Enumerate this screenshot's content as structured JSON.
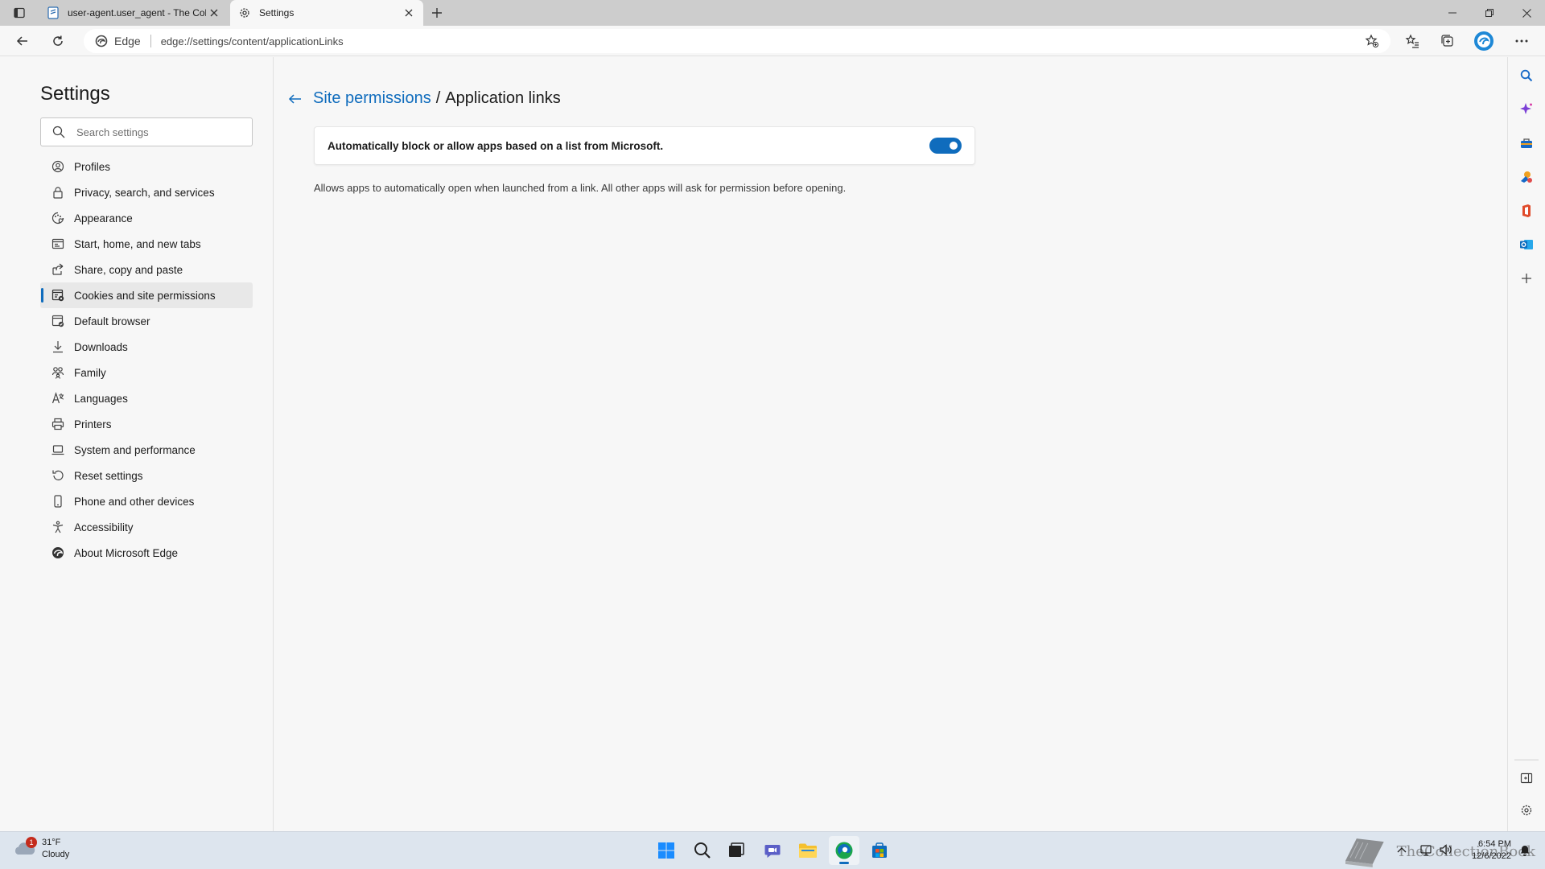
{
  "browser": {
    "tabs": [
      {
        "title": "user-agent.user_agent - The Coll",
        "icon": "document-icon"
      },
      {
        "title": "Settings",
        "icon": "gear-icon"
      }
    ],
    "address": {
      "edge_label": "Edge",
      "url": "edge://settings/content/applicationLinks"
    }
  },
  "settings": {
    "title": "Settings",
    "search_placeholder": "Search settings",
    "nav": [
      {
        "label": "Profiles",
        "icon": "profile-icon"
      },
      {
        "label": "Privacy, search, and services",
        "icon": "lock-icon"
      },
      {
        "label": "Appearance",
        "icon": "appearance-icon"
      },
      {
        "label": "Start, home, and new tabs",
        "icon": "start-icon"
      },
      {
        "label": "Share, copy and paste",
        "icon": "share-icon"
      },
      {
        "label": "Cookies and site permissions",
        "icon": "cookies-icon",
        "active": true
      },
      {
        "label": "Default browser",
        "icon": "browser-icon"
      },
      {
        "label": "Downloads",
        "icon": "download-icon"
      },
      {
        "label": "Family",
        "icon": "family-icon"
      },
      {
        "label": "Languages",
        "icon": "languages-icon"
      },
      {
        "label": "Printers",
        "icon": "printer-icon"
      },
      {
        "label": "System and performance",
        "icon": "laptop-icon"
      },
      {
        "label": "Reset settings",
        "icon": "reset-icon"
      },
      {
        "label": "Phone and other devices",
        "icon": "phone-icon"
      },
      {
        "label": "Accessibility",
        "icon": "accessibility-icon"
      },
      {
        "label": "About Microsoft Edge",
        "icon": "edge-icon"
      }
    ]
  },
  "page": {
    "breadcrumb_parent": "Site permissions",
    "breadcrumb_separator": "/",
    "breadcrumb_current": "Application links",
    "setting_label": "Automatically block or allow apps based on a list from Microsoft.",
    "setting_enabled": true,
    "description": "Allows apps to automatically open when launched from a link. All other apps will ask for permission before opening."
  },
  "taskbar": {
    "weather_temp": "31°F",
    "weather_condition": "Cloudy",
    "weather_badge": "1",
    "watermark": "TheCollectionBook",
    "time": "6:54 PM",
    "date": "12/6/2022"
  },
  "colors": {
    "accent": "#0f6cbd",
    "tabstrip": "#cdcdcd",
    "background": "#f7f7f7",
    "taskbar": "#dde5ee"
  }
}
